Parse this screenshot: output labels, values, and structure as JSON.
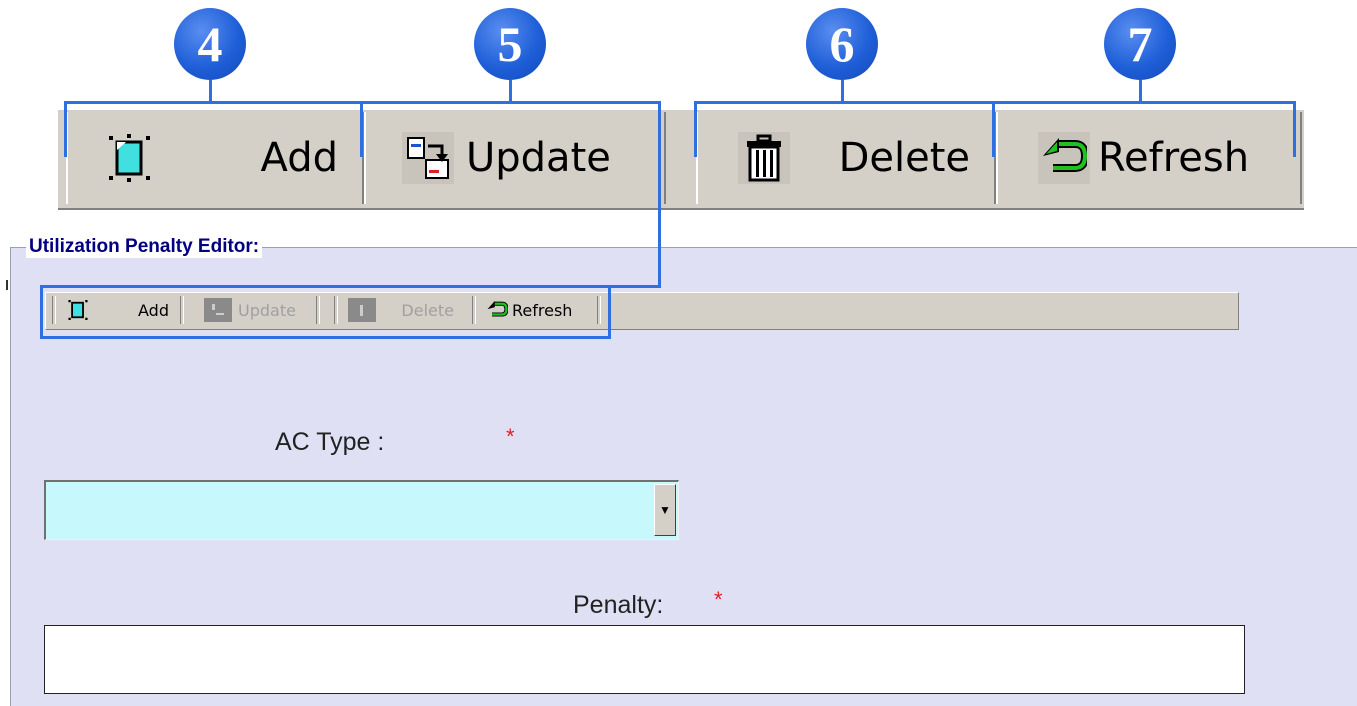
{
  "callouts": [
    "4",
    "5",
    "6",
    "7"
  ],
  "zoom_toolbar": {
    "add": {
      "label": "Add",
      "icon": "add-document-icon"
    },
    "update": {
      "label": "Update",
      "icon": "update-icon"
    },
    "delete": {
      "label": "Delete",
      "icon": "trash-icon"
    },
    "refresh": {
      "label": "Refresh",
      "icon": "refresh-arrow-icon"
    }
  },
  "editor": {
    "title": "Utilization Penalty Editor:",
    "toolbar": {
      "add": "Add",
      "update": "Update",
      "delete": "Delete",
      "refresh": "Refresh"
    },
    "ac_type": {
      "label": "AC Type :",
      "required_mark": "*",
      "value": ""
    },
    "penalty": {
      "label": "Penalty:",
      "required_mark": "*",
      "value": ""
    }
  },
  "colors": {
    "accent": "#2f6fe0",
    "panel_bg": "#e0e0f4",
    "combo_bg": "#c6f8fc",
    "title": "#000080",
    "required": "#e02020"
  }
}
